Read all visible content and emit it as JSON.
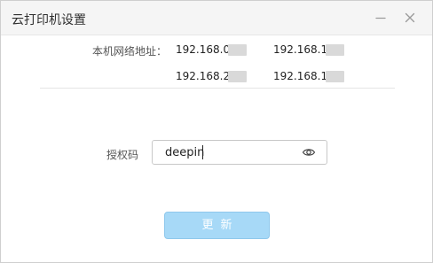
{
  "window": {
    "title": "云打印机设置"
  },
  "titlebar": {
    "minimize_icon": "minimize-icon",
    "close_icon": "close-icon"
  },
  "network": {
    "label": "本机网络地址：",
    "addresses": [
      "192.168.0.",
      "192.168.1.",
      "192.168.22",
      "192.168.18"
    ]
  },
  "auth": {
    "label": "授权码",
    "value": "deepin",
    "visibility_icon": "eye-icon"
  },
  "actions": {
    "update_label": "更新"
  },
  "colors": {
    "accent": "#a7d9f7",
    "accent_border": "#8fc8ec",
    "titlebar_bg": "#f5f5f5"
  }
}
